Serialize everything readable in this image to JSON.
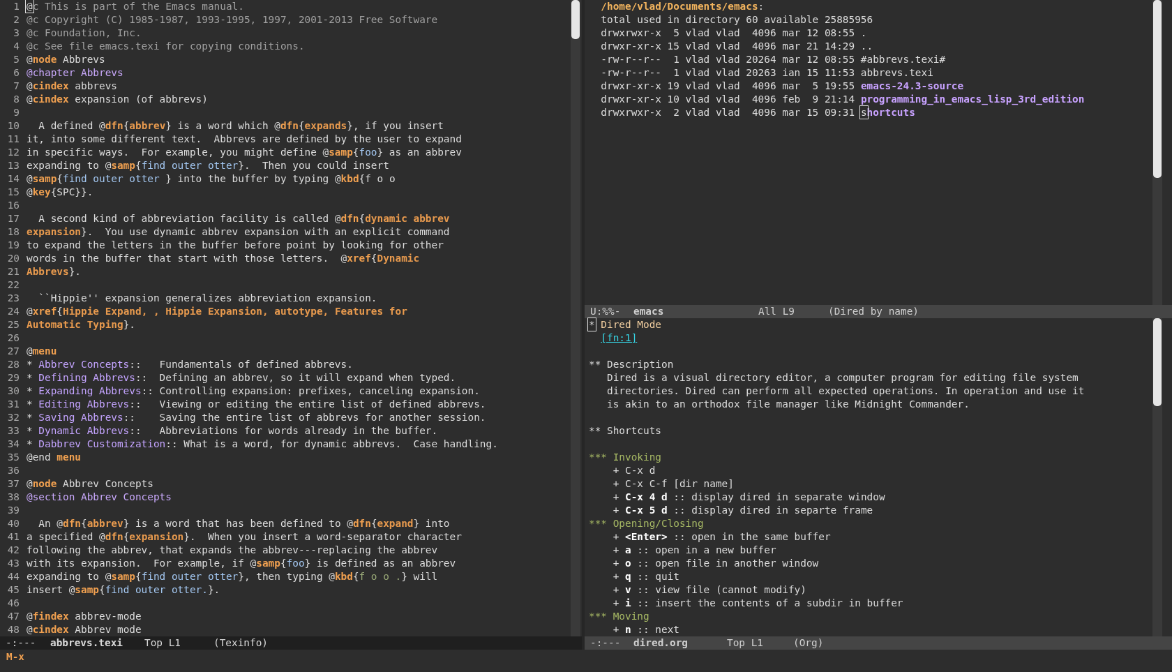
{
  "left": {
    "lines": [
      {
        "number": "1",
        "segments": [
          {
            "kind": "cursor",
            "text": "@"
          },
          {
            "kind": "comment",
            "text": "c This is part of the Emacs manual."
          }
        ]
      },
      {
        "number": "2",
        "segments": [
          {
            "kind": "comment",
            "text": "@c Copyright (C) 1985-1987, 1993-1995, 1997, 2001-2013 Free Software"
          }
        ]
      },
      {
        "number": "3",
        "segments": [
          {
            "kind": "comment",
            "text": "@c Foundation, Inc."
          }
        ]
      },
      {
        "number": "4",
        "segments": [
          {
            "kind": "comment",
            "text": "@c See file emacs.texi for copying conditions."
          }
        ]
      },
      {
        "number": "5",
        "segments": [
          {
            "kind": "plain",
            "text": "@"
          },
          {
            "kind": "keyword",
            "text": "node"
          },
          {
            "kind": "plain",
            "text": " Abbrevs"
          }
        ]
      },
      {
        "number": "6",
        "segments": [
          {
            "kind": "section",
            "text": "@chapter Abbrevs"
          }
        ]
      },
      {
        "number": "7",
        "segments": [
          {
            "kind": "plain",
            "text": "@"
          },
          {
            "kind": "keyword",
            "text": "cindex"
          },
          {
            "kind": "plain",
            "text": " abbrevs"
          }
        ]
      },
      {
        "number": "8",
        "segments": [
          {
            "kind": "plain",
            "text": "@"
          },
          {
            "kind": "keyword",
            "text": "cindex"
          },
          {
            "kind": "plain",
            "text": " expansion (of abbrevs)"
          }
        ]
      },
      {
        "number": "9"
      },
      {
        "number": "10",
        "segments": [
          {
            "kind": "plain",
            "text": "  A defined @"
          },
          {
            "kind": "keyword",
            "text": "dfn"
          },
          {
            "kind": "plain",
            "text": "{"
          },
          {
            "kind": "arg",
            "text": "abbrev"
          },
          {
            "kind": "plain",
            "text": "} is a word which @"
          },
          {
            "kind": "keyword",
            "text": "dfn"
          },
          {
            "kind": "plain",
            "text": "{"
          },
          {
            "kind": "arg",
            "text": "expands"
          },
          {
            "kind": "plain",
            "text": "}, if you insert"
          }
        ]
      },
      {
        "number": "11",
        "segments": [
          {
            "kind": "plain",
            "text": "it, into some different text.  Abbrevs are defined by the user to expand"
          }
        ]
      },
      {
        "number": "12",
        "segments": [
          {
            "kind": "plain",
            "text": "in specific ways.  For example, you might define @"
          },
          {
            "kind": "keyword",
            "text": "samp"
          },
          {
            "kind": "plain",
            "text": "{"
          },
          {
            "kind": "samp",
            "text": "foo"
          },
          {
            "kind": "plain",
            "text": "} as an abbrev"
          }
        ]
      },
      {
        "number": "13",
        "segments": [
          {
            "kind": "plain",
            "text": "expanding to @"
          },
          {
            "kind": "keyword",
            "text": "samp"
          },
          {
            "kind": "plain",
            "text": "{"
          },
          {
            "kind": "samp",
            "text": "find outer otter"
          },
          {
            "kind": "plain",
            "text": "}.  Then you could insert"
          }
        ]
      },
      {
        "number": "14",
        "segments": [
          {
            "kind": "plain",
            "text": "@"
          },
          {
            "kind": "keyword",
            "text": "samp"
          },
          {
            "kind": "plain",
            "text": "{"
          },
          {
            "kind": "samp",
            "text": "find outer otter "
          },
          {
            "kind": "plain",
            "text": "} into the buffer by typing @"
          },
          {
            "kind": "keyword",
            "text": "kbd"
          },
          {
            "kind": "plain",
            "text": "{f o o"
          }
        ]
      },
      {
        "number": "15",
        "segments": [
          {
            "kind": "plain",
            "text": "@"
          },
          {
            "kind": "keyword",
            "text": "key"
          },
          {
            "kind": "plain",
            "text": "{SPC}}."
          }
        ]
      },
      {
        "number": "16"
      },
      {
        "number": "17",
        "segments": [
          {
            "kind": "plain",
            "text": "  A second kind of abbreviation facility is called @"
          },
          {
            "kind": "keyword",
            "text": "dfn"
          },
          {
            "kind": "plain",
            "text": "{"
          },
          {
            "kind": "arg",
            "text": "dynamic abbrev"
          }
        ]
      },
      {
        "number": "18",
        "segments": [
          {
            "kind": "arg",
            "text": "expansion"
          },
          {
            "kind": "plain",
            "text": "}.  You use dynamic abbrev expansion with an explicit command"
          }
        ]
      },
      {
        "number": "19",
        "segments": [
          {
            "kind": "plain",
            "text": "to expand the letters in the buffer before point by looking for other"
          }
        ]
      },
      {
        "number": "20",
        "segments": [
          {
            "kind": "plain",
            "text": "words in the buffer that start with those letters.  @"
          },
          {
            "kind": "keyword",
            "text": "xref"
          },
          {
            "kind": "plain",
            "text": "{"
          },
          {
            "kind": "arg",
            "text": "Dynamic"
          }
        ]
      },
      {
        "number": "21",
        "segments": [
          {
            "kind": "arg",
            "text": "Abbrevs"
          },
          {
            "kind": "plain",
            "text": "}."
          }
        ]
      },
      {
        "number": "22"
      },
      {
        "number": "23",
        "segments": [
          {
            "kind": "plain",
            "text": "  ``Hippie'' expansion generalizes abbreviation expansion."
          }
        ]
      },
      {
        "number": "24",
        "segments": [
          {
            "kind": "plain",
            "text": "@"
          },
          {
            "kind": "keyword",
            "text": "xref"
          },
          {
            "kind": "plain",
            "text": "{"
          },
          {
            "kind": "arg",
            "text": "Hippie Expand, , Hippie Expansion, autotype, Features for"
          }
        ]
      },
      {
        "number": "25",
        "segments": [
          {
            "kind": "arg",
            "text": "Automatic Typing"
          },
          {
            "kind": "plain",
            "text": "}."
          }
        ]
      },
      {
        "number": "26"
      },
      {
        "number": "27",
        "segments": [
          {
            "kind": "plain",
            "text": "@"
          },
          {
            "kind": "keyword",
            "text": "menu"
          }
        ]
      },
      {
        "number": "28",
        "segments": [
          {
            "kind": "plain",
            "text": "* "
          },
          {
            "kind": "menu",
            "text": "Abbrev Concepts"
          },
          {
            "kind": "plain",
            "text": "::   Fundamentals of defined abbrevs."
          }
        ]
      },
      {
        "number": "29",
        "segments": [
          {
            "kind": "plain",
            "text": "* "
          },
          {
            "kind": "menu",
            "text": "Defining Abbrevs"
          },
          {
            "kind": "plain",
            "text": "::  Defining an abbrev, so it will expand when typed."
          }
        ]
      },
      {
        "number": "30",
        "segments": [
          {
            "kind": "plain",
            "text": "* "
          },
          {
            "kind": "menu",
            "text": "Expanding Abbrevs"
          },
          {
            "kind": "plain",
            "text": ":: Controlling expansion: prefixes, canceling expansion."
          }
        ]
      },
      {
        "number": "31",
        "segments": [
          {
            "kind": "plain",
            "text": "* "
          },
          {
            "kind": "menu",
            "text": "Editing Abbrevs"
          },
          {
            "kind": "plain",
            "text": "::   Viewing or editing the entire list of defined abbrevs."
          }
        ]
      },
      {
        "number": "32",
        "segments": [
          {
            "kind": "plain",
            "text": "* "
          },
          {
            "kind": "menu",
            "text": "Saving Abbrevs"
          },
          {
            "kind": "plain",
            "text": "::    Saving the entire list of abbrevs for another session."
          }
        ]
      },
      {
        "number": "33",
        "segments": [
          {
            "kind": "plain",
            "text": "* "
          },
          {
            "kind": "menu",
            "text": "Dynamic Abbrevs"
          },
          {
            "kind": "plain",
            "text": "::   Abbreviations for words already in the buffer."
          }
        ]
      },
      {
        "number": "34",
        "segments": [
          {
            "kind": "plain",
            "text": "* "
          },
          {
            "kind": "menu",
            "text": "Dabbrev Customization"
          },
          {
            "kind": "plain",
            "text": ":: What is a word, for dynamic abbrevs.  Case handling."
          }
        ]
      },
      {
        "number": "35",
        "segments": [
          {
            "kind": "plain",
            "text": "@end "
          },
          {
            "kind": "keyword",
            "text": "menu"
          }
        ]
      },
      {
        "number": "36"
      },
      {
        "number": "37",
        "segments": [
          {
            "kind": "plain",
            "text": "@"
          },
          {
            "kind": "keyword",
            "text": "node"
          },
          {
            "kind": "plain",
            "text": " Abbrev Concepts"
          }
        ]
      },
      {
        "number": "38",
        "segments": [
          {
            "kind": "section",
            "text": "@section Abbrev Concepts"
          }
        ]
      },
      {
        "number": "39"
      },
      {
        "number": "40",
        "segments": [
          {
            "kind": "plain",
            "text": "  An @"
          },
          {
            "kind": "keyword",
            "text": "dfn"
          },
          {
            "kind": "plain",
            "text": "{"
          },
          {
            "kind": "arg",
            "text": "abbrev"
          },
          {
            "kind": "plain",
            "text": "} is a word that has been defined to @"
          },
          {
            "kind": "keyword",
            "text": "dfn"
          },
          {
            "kind": "plain",
            "text": "{"
          },
          {
            "kind": "arg",
            "text": "expand"
          },
          {
            "kind": "plain",
            "text": "} into"
          }
        ]
      },
      {
        "number": "41",
        "segments": [
          {
            "kind": "plain",
            "text": "a specified @"
          },
          {
            "kind": "keyword",
            "text": "dfn"
          },
          {
            "kind": "plain",
            "text": "{"
          },
          {
            "kind": "arg",
            "text": "expansion"
          },
          {
            "kind": "plain",
            "text": "}.  When you insert a word-separator character"
          }
        ]
      },
      {
        "number": "42",
        "segments": [
          {
            "kind": "plain",
            "text": "following the abbrev, that expands the abbrev---replacing the abbrev"
          }
        ]
      },
      {
        "number": "43",
        "segments": [
          {
            "kind": "plain",
            "text": "with its expansion.  For example, if @"
          },
          {
            "kind": "keyword",
            "text": "samp"
          },
          {
            "kind": "plain",
            "text": "{"
          },
          {
            "kind": "samp",
            "text": "foo"
          },
          {
            "kind": "plain",
            "text": "} is defined as an abbrev"
          }
        ]
      },
      {
        "number": "44",
        "segments": [
          {
            "kind": "plain",
            "text": "expanding to @"
          },
          {
            "kind": "keyword",
            "text": "samp"
          },
          {
            "kind": "plain",
            "text": "{"
          },
          {
            "kind": "samp",
            "text": "find outer otter"
          },
          {
            "kind": "plain",
            "text": "}, then typing @"
          },
          {
            "kind": "keyword",
            "text": "kbd"
          },
          {
            "kind": "plain",
            "text": "{"
          },
          {
            "kind": "kbd",
            "text": "f o o ."
          },
          {
            "kind": "plain",
            "text": "} will"
          }
        ]
      },
      {
        "number": "45",
        "segments": [
          {
            "kind": "plain",
            "text": "insert @"
          },
          {
            "kind": "keyword",
            "text": "samp"
          },
          {
            "kind": "plain",
            "text": "{"
          },
          {
            "kind": "samp",
            "text": "find outer otter."
          },
          {
            "kind": "plain",
            "text": "}."
          }
        ]
      },
      {
        "number": "46"
      },
      {
        "number": "47",
        "segments": [
          {
            "kind": "plain",
            "text": "@"
          },
          {
            "kind": "keyword",
            "text": "findex"
          },
          {
            "kind": "plain",
            "text": " abbrev-mode"
          }
        ]
      },
      {
        "number": "48",
        "segments": [
          {
            "kind": "plain",
            "text": "@"
          },
          {
            "kind": "keyword",
            "text": "cindex"
          },
          {
            "kind": "plain",
            "text": " Abbrev mode"
          }
        ]
      }
    ],
    "mode_line": {
      "active": true,
      "status": "-:---",
      "buffer": "abbrevs.texi",
      "position": "Top L1",
      "mode": "(Texinfo)"
    }
  },
  "right_top": {
    "lines": [
      {
        "segments": [
          {
            "kind": "path",
            "text": "/home/vlad/Documents/emacs"
          },
          {
            "kind": "plain",
            "text": ":"
          }
        ]
      },
      {
        "segments": [
          {
            "kind": "plain",
            "text": "total used in directory 60 available 25885956"
          }
        ]
      },
      {
        "segments": [
          {
            "kind": "plain",
            "text": "drwxrwxr-x  5 vlad vlad  4096 mar 12 08:55 ."
          }
        ]
      },
      {
        "segments": [
          {
            "kind": "plain",
            "text": "drwxr-xr-x 15 vlad vlad  4096 mar 21 14:29 .."
          }
        ]
      },
      {
        "segments": [
          {
            "kind": "plain",
            "text": "-rw-r--r--  1 vlad vlad 20264 mar 12 08:55 #abbrevs.texi#"
          }
        ]
      },
      {
        "segments": [
          {
            "kind": "plain",
            "text": "-rw-r--r--  1 vlad vlad 20263 ian 15 11:53 abbrevs.texi"
          }
        ]
      },
      {
        "segments": [
          {
            "kind": "plain",
            "text": "drwxr-xr-x 19 vlad vlad  4096 mar  5 19:55 "
          },
          {
            "kind": "dir",
            "text": "emacs-24.3-source"
          }
        ]
      },
      {
        "segments": [
          {
            "kind": "plain",
            "text": "drwxr-xr-x 10 vlad vlad  4096 feb  9 21:14 "
          },
          {
            "kind": "dir",
            "text": "programming_in_emacs_lisp_3rd_edition"
          }
        ]
      },
      {
        "segments": [
          {
            "kind": "plain",
            "text": "drwxrwxr-x  2 vlad vlad  4096 mar 15 09:31 "
          },
          {
            "kind": "cursor",
            "text": "s"
          },
          {
            "kind": "dir",
            "text": "hortcuts"
          }
        ]
      }
    ],
    "mode_line": {
      "active": false,
      "status": "U:%%-",
      "buffer": "emacs",
      "position": "All L9",
      "mode": "(Dired by name)"
    }
  },
  "right_bottom": {
    "lines": [
      {
        "segments": [
          {
            "kind": "cursor",
            "text": "*"
          },
          {
            "kind": "org1",
            "text": " Dired Mode"
          }
        ]
      },
      {
        "kind": "text",
        "segments": [
          {
            "kind": "link",
            "text": "[fn:1]"
          }
        ]
      },
      {
        "kind": "blank"
      },
      {
        "segments": [
          {
            "kind": "plain",
            "text": "** Description"
          }
        ]
      },
      {
        "segments": [
          {
            "kind": "plain",
            "text": "   Dired is a visual directory editor, a computer program for editing file system"
          }
        ]
      },
      {
        "segments": [
          {
            "kind": "plain",
            "text": "   directories. Dired can perform all expected operations. In operation and use it"
          }
        ]
      },
      {
        "segments": [
          {
            "kind": "plain",
            "text": "   is akin to an orthodox file manager like Midnight Commander."
          }
        ]
      },
      {
        "kind": "blank"
      },
      {
        "segments": [
          {
            "kind": "plain",
            "text": "** Shortcuts"
          }
        ]
      },
      {
        "kind": "blank"
      },
      {
        "segments": [
          {
            "kind": "org3",
            "text": "*** Invoking"
          }
        ]
      },
      {
        "segments": [
          {
            "kind": "plain",
            "text": "    + C-x d"
          }
        ]
      },
      {
        "segments": [
          {
            "kind": "plain",
            "text": "    + C-x C-f [dir name]"
          }
        ]
      },
      {
        "segments": [
          {
            "kind": "plain",
            "text": "    + "
          },
          {
            "kind": "bold",
            "text": "C-x 4 d"
          },
          {
            "kind": "plain",
            "text": " :: display dired in separate window"
          }
        ]
      },
      {
        "segments": [
          {
            "kind": "plain",
            "text": "    + "
          },
          {
            "kind": "bold",
            "text": "C-x 5 d"
          },
          {
            "kind": "plain",
            "text": " :: display dired in separte frame"
          }
        ]
      },
      {
        "segments": [
          {
            "kind": "org3",
            "text": "*** Opening/Closing"
          }
        ]
      },
      {
        "segments": [
          {
            "kind": "plain",
            "text": "    + "
          },
          {
            "kind": "bold",
            "text": "<Enter>"
          },
          {
            "kind": "plain",
            "text": " :: open in the same buffer"
          }
        ]
      },
      {
        "segments": [
          {
            "kind": "plain",
            "text": "    + "
          },
          {
            "kind": "bold",
            "text": "a"
          },
          {
            "kind": "plain",
            "text": " :: open in a new buffer"
          }
        ]
      },
      {
        "segments": [
          {
            "kind": "plain",
            "text": "    + "
          },
          {
            "kind": "bold",
            "text": "o"
          },
          {
            "kind": "plain",
            "text": " :: open file in another window"
          }
        ]
      },
      {
        "segments": [
          {
            "kind": "plain",
            "text": "    + "
          },
          {
            "kind": "bold",
            "text": "q"
          },
          {
            "kind": "plain",
            "text": " :: quit"
          }
        ]
      },
      {
        "segments": [
          {
            "kind": "plain",
            "text": "    + "
          },
          {
            "kind": "bold",
            "text": "v"
          },
          {
            "kind": "plain",
            "text": " :: view file (cannot modify)"
          }
        ]
      },
      {
        "segments": [
          {
            "kind": "plain",
            "text": "    + "
          },
          {
            "kind": "bold",
            "text": "i"
          },
          {
            "kind": "plain",
            "text": " :: insert the contents of a subdir in buffer"
          }
        ]
      },
      {
        "segments": [
          {
            "kind": "org3",
            "text": "*** Moving"
          }
        ]
      },
      {
        "segments": [
          {
            "kind": "plain",
            "text": "    + "
          },
          {
            "kind": "bold",
            "text": "n"
          },
          {
            "kind": "plain",
            "text": " :: next"
          }
        ]
      }
    ],
    "mode_line": {
      "active": false,
      "status": "-:---",
      "buffer": "dired.org",
      "position": "Top L1",
      "mode": "(Org)"
    }
  },
  "minibuffer": {
    "prompt": "M-x"
  }
}
